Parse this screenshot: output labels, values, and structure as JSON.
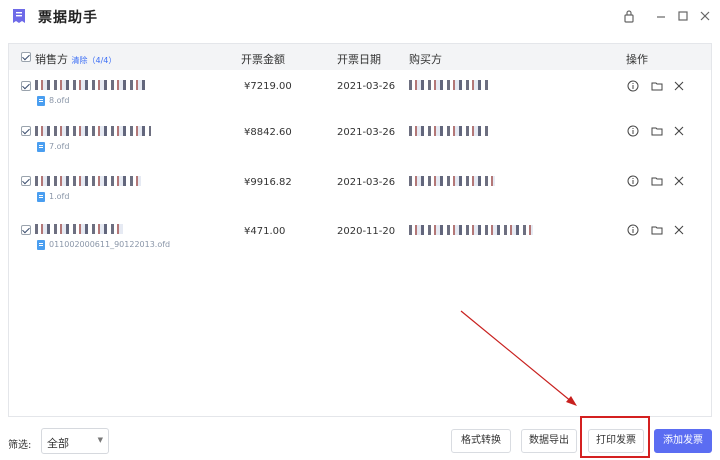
{
  "app": {
    "title": "票据助手",
    "icon": "receipt-icon",
    "accent": "#5b6df2"
  },
  "window_controls": [
    "lock-icon",
    "minimize-icon",
    "maximize-icon",
    "close-icon"
  ],
  "table": {
    "headers": {
      "seller": "销售方",
      "clear_text": "清除（4/4）",
      "amount": "开票金额",
      "date": "开票日期",
      "buyer": "购买方",
      "actions": "操作"
    },
    "rows": [
      {
        "file": "8.ofd",
        "amount": "¥7219.00",
        "date": "2021-03-26"
      },
      {
        "file": "7.ofd",
        "amount": "¥8842.60",
        "date": "2021-03-26"
      },
      {
        "file": "1.ofd",
        "amount": "¥9916.82",
        "date": "2021-03-26"
      },
      {
        "file": "011002000611_90122013.ofd",
        "amount": "¥471.00",
        "date": "2020-11-20"
      }
    ],
    "row_actions": [
      "info-icon",
      "folder-icon",
      "delete-icon"
    ]
  },
  "footer": {
    "filter_label": "筛选:",
    "filter_value": "全部",
    "buttons": {
      "convert": "格式转换",
      "export": "数据导出",
      "print": "打印发票",
      "add": "添加发票"
    }
  },
  "annotation": {
    "color": "#d42020"
  }
}
